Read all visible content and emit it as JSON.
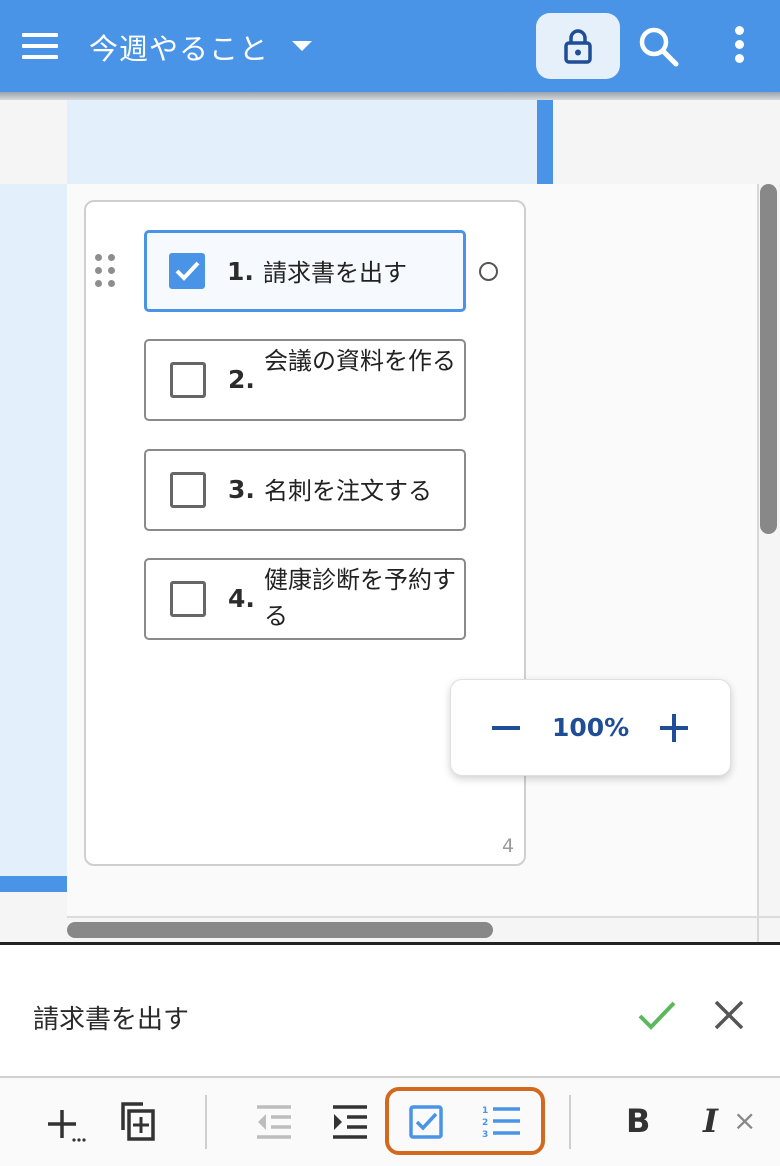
{
  "app_bar": {
    "title": "今週やること",
    "icons": [
      "menu-icon",
      "dropdown-caret-icon",
      "lock-icon",
      "search-icon",
      "more-vert-icon"
    ],
    "accent_color": "#4a94e8"
  },
  "card": {
    "items": [
      {
        "number": "1.",
        "text": "請求書を出す",
        "checked": true,
        "selected": true
      },
      {
        "number": "2.",
        "text": "会議の資料を作る",
        "checked": false,
        "selected": false
      },
      {
        "number": "3.",
        "text": "名刺を注文する",
        "checked": false,
        "selected": false
      },
      {
        "number": "4.",
        "text": "健康診断を予約する",
        "checked": false,
        "selected": false
      }
    ],
    "page_number": "4"
  },
  "zoom": {
    "minus_label": "−",
    "value": "100%",
    "plus_label": "+"
  },
  "edit_bar": {
    "value": "請求書を出す",
    "confirm_color": "#5cb85c",
    "cancel_color": "#555555"
  },
  "toolbar": {
    "tools": [
      "add-more-icon",
      "duplicate-icon",
      "outdent-icon",
      "indent-icon",
      "checklist-icon",
      "numbered-list-icon",
      "bold-icon",
      "italic-icon",
      "clear-format-icon"
    ],
    "bold_label": "B",
    "italic_label": "I",
    "clear_label": "×",
    "highlight_color": "#d2691e"
  }
}
